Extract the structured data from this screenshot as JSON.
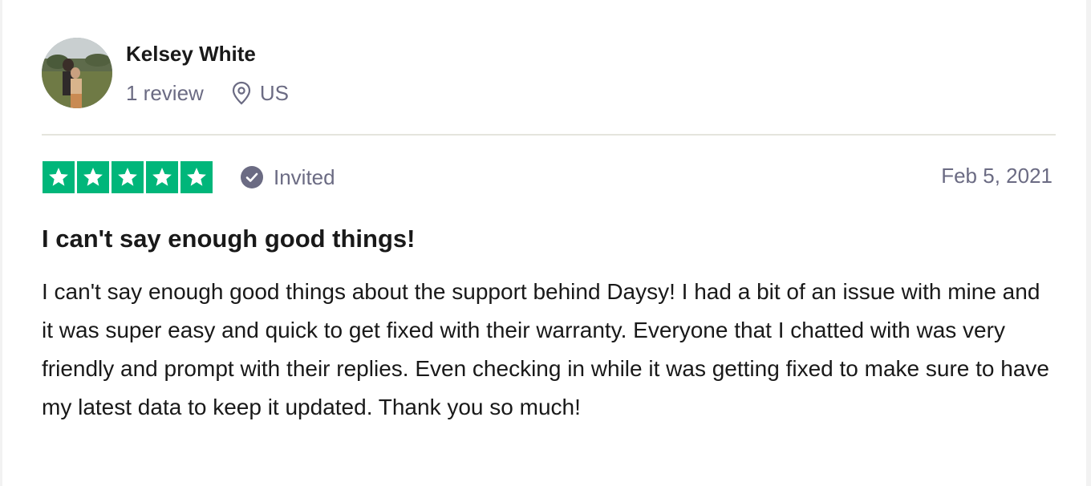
{
  "reviewer": {
    "name": "Kelsey White",
    "review_count": "1 review",
    "country": "US",
    "avatar_icon": "profile-photo"
  },
  "rating": {
    "stars": 5,
    "max_stars": 5,
    "star_color": "#00b67a",
    "star_icon": "star-icon"
  },
  "verification": {
    "label": "Invited",
    "icon": "checkmark-circle-icon"
  },
  "review": {
    "date": "Feb 5, 2021",
    "title": "I can't say enough good things!",
    "body": "I can't say enough good things about the support behind Daysy! I had a bit of an issue with mine and it was super easy and quick to get fixed with their warranty. Everyone that I chatted with was very friendly and prompt with their replies. Even checking in while it was getting fixed to make sure to have my latest data to keep it updated. Thank you so much!"
  },
  "colors": {
    "text_primary": "#191919",
    "text_secondary": "#6b6b83",
    "divider": "#e5e5dd"
  }
}
